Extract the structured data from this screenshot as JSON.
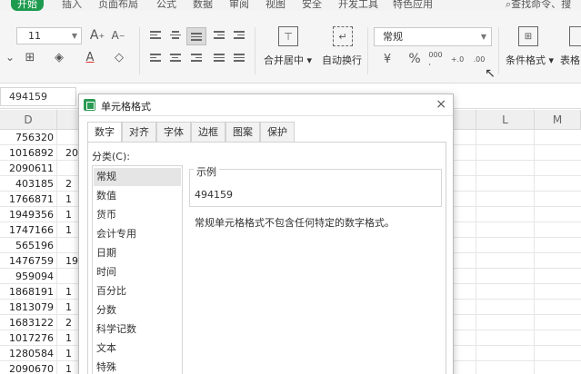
{
  "menu": {
    "tabs": [
      "开始",
      "插入",
      "页面布局",
      "公式",
      "数据",
      "审阅",
      "视图",
      "安全",
      "开发工具",
      "特色应用"
    ],
    "search": "查找命令、搜"
  },
  "ribbon": {
    "font_size": "11",
    "number_format": "常规",
    "merge_center": "合并居中",
    "wrap_text": "自动换行",
    "cond_format": "条件格式",
    "table_style": "表格",
    "percent": "%",
    "grow_font": "A⁺",
    "shrink_font": "A⁻",
    "font_color": "A"
  },
  "formula_bar": {
    "name_box": "494159"
  },
  "grid": {
    "columns": [
      "D",
      "L",
      "M"
    ],
    "column_d_values": [
      "756320",
      "1016892",
      "2090611",
      "403185",
      "1766871",
      "1949356",
      "1747166",
      "565196",
      "1476759",
      "959094",
      "1868191",
      "1813079",
      "1683122",
      "1017276",
      "1280584",
      "2090670"
    ],
    "column_e_partial": [
      "",
      "20",
      "",
      "2",
      "1",
      "1",
      "1",
      "",
      "19",
      "",
      "1",
      "1",
      "2",
      "1",
      "1",
      "1"
    ]
  },
  "dialog": {
    "title": "单元格格式",
    "close": "×",
    "tabs": [
      "数字",
      "对齐",
      "字体",
      "边框",
      "图案",
      "保护"
    ],
    "active_tab": "数字",
    "category_label": "分类(C):",
    "categories": [
      "常规",
      "数值",
      "货币",
      "会计专用",
      "日期",
      "时间",
      "百分比",
      "分数",
      "科学记数",
      "文本",
      "特殊"
    ],
    "selected_category": "常规",
    "sample_label": "示例",
    "sample_value": "494159",
    "description": "常规单元格格式不包含任何特定的数字格式。"
  },
  "colors": {
    "accent": "#1e9b4f",
    "dialog_icon": "#2a9a54"
  }
}
